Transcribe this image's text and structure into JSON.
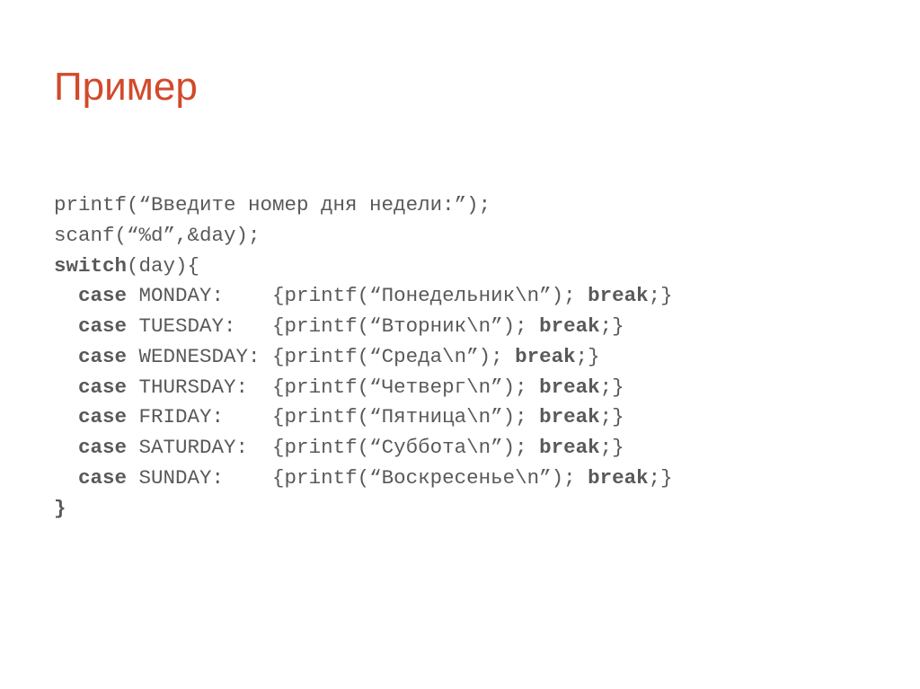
{
  "title": "Пример",
  "code": {
    "l1": "printf(“Введите номер дня недели:”);",
    "l2": "scanf(“%d”,&day);",
    "l3a": "switch",
    "l3b": "(day){",
    "l4a": "  ",
    "l4b": "case",
    "l4c": " MONDAY:    {printf(“Понедельник\\n”); ",
    "l4d": "break",
    "l4e": ";}",
    "l5a": "  ",
    "l5b": "case",
    "l5c": " TUESDAY:   {printf(“Вторник\\n”); ",
    "l5d": "break",
    "l5e": ";}",
    "l6a": "  ",
    "l6b": "case",
    "l6c": " WEDNESDAY: {printf(“Среда\\n”); ",
    "l6d": "break",
    "l6e": ";}",
    "l7a": "  ",
    "l7b": "case",
    "l7c": " THURSDAY:  {printf(“Четверг\\n”); ",
    "l7d": "break",
    "l7e": ";}",
    "l8a": "  ",
    "l8b": "case",
    "l8c": " FRIDAY:    {printf(“Пятница\\n”); ",
    "l8d": "break",
    "l8e": ";}",
    "l9a": "  ",
    "l9b": "case",
    "l9c": " SATURDAY:  {printf(“Суббота\\n”); ",
    "l9d": "break",
    "l9e": ";}",
    "l10a": "  ",
    "l10b": "case",
    "l10c": " SUNDAY:    {printf(“Воскресенье\\n”); ",
    "l10d": "break",
    "l10e": ";}",
    "l11": "}"
  }
}
